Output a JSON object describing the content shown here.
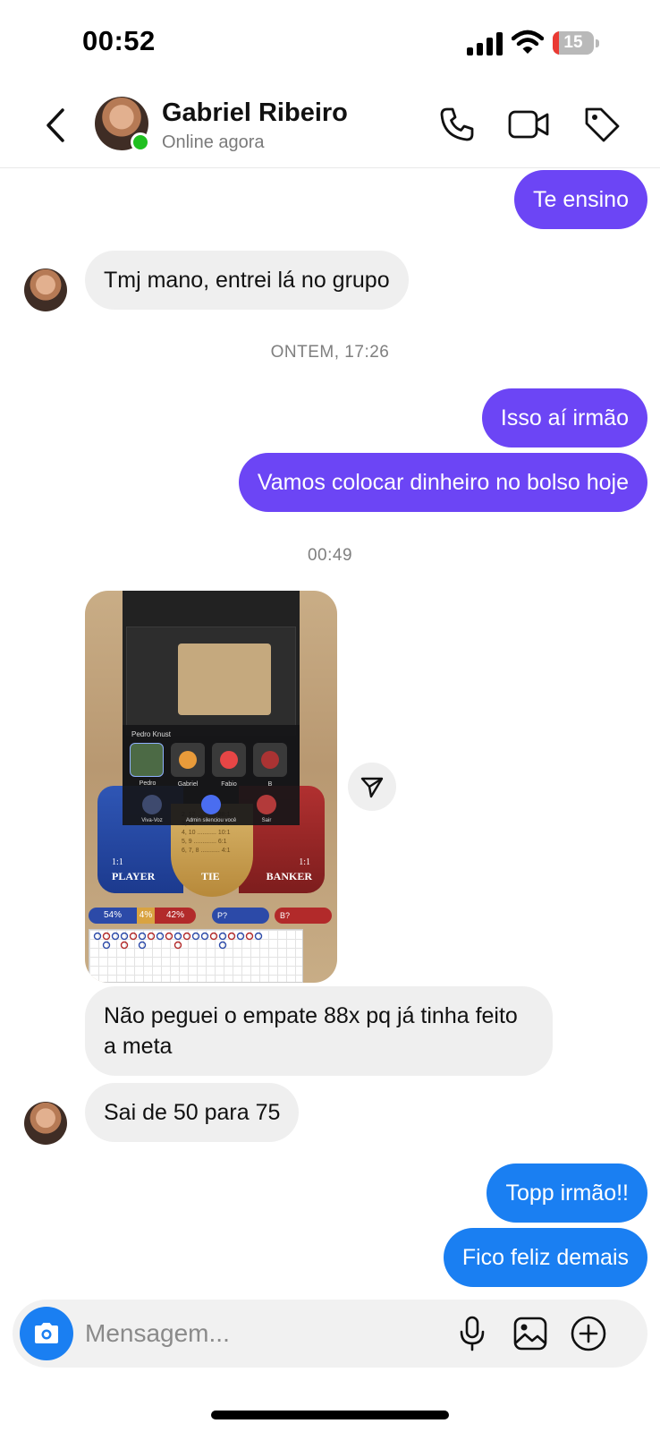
{
  "status_bar": {
    "time": "00:52",
    "battery": "15",
    "battery_level": 0.15,
    "battery_color": "#ea3a33"
  },
  "header": {
    "contact_name": "Gabriel Ribeiro",
    "status": "Online agora",
    "online_color": "#1fc01f",
    "icons": [
      "back-chevron-icon",
      "phone-icon",
      "video-camera-icon",
      "tag-icon"
    ]
  },
  "colors": {
    "sent_purple": "#6c45f5",
    "sent_blue": "#1a7ff2",
    "received": "#efefef"
  },
  "messages": {
    "m1": "Te ensino",
    "m2": "Tmj mano, entrei lá no grupo",
    "ts1": "ONTEM, 17:26",
    "m3": "Isso aí irmão",
    "m4": "Vamos colocar dinheiro no bolso hoje",
    "ts2": "00:49",
    "m5": "Não peguei o empate 88x pq já tinha feito a meta",
    "m6": "Sai de 50 para 75",
    "m7": "Topp irmão!!",
    "m8": "Fico feliz demais"
  },
  "shared_image": {
    "caller": "Pedro Knust",
    "participants": [
      "Pedro",
      "Gabriel",
      "Fabio",
      "B"
    ],
    "controls": [
      "Viva-Voz",
      "Admin silenciou você",
      "Sair"
    ],
    "player_label": "PLAYER",
    "player_odds": "1:1",
    "tie_label": "TIE",
    "banker_label": "BANKER",
    "banker_odds": "1:1",
    "tie_odds": "2, 12 ........... 88:1\n3, 11 ........... 25:1\n4, 10 ........... 10:1\n5, 9 ............. 6:1\n6, 7, 8 ........... 4:1",
    "player_pct": "54%",
    "tie_pct": "4%",
    "banker_pct": "42%",
    "p_label": "P?",
    "b_label": "B?"
  },
  "composer": {
    "placeholder": "Mensagem...",
    "value": ""
  }
}
